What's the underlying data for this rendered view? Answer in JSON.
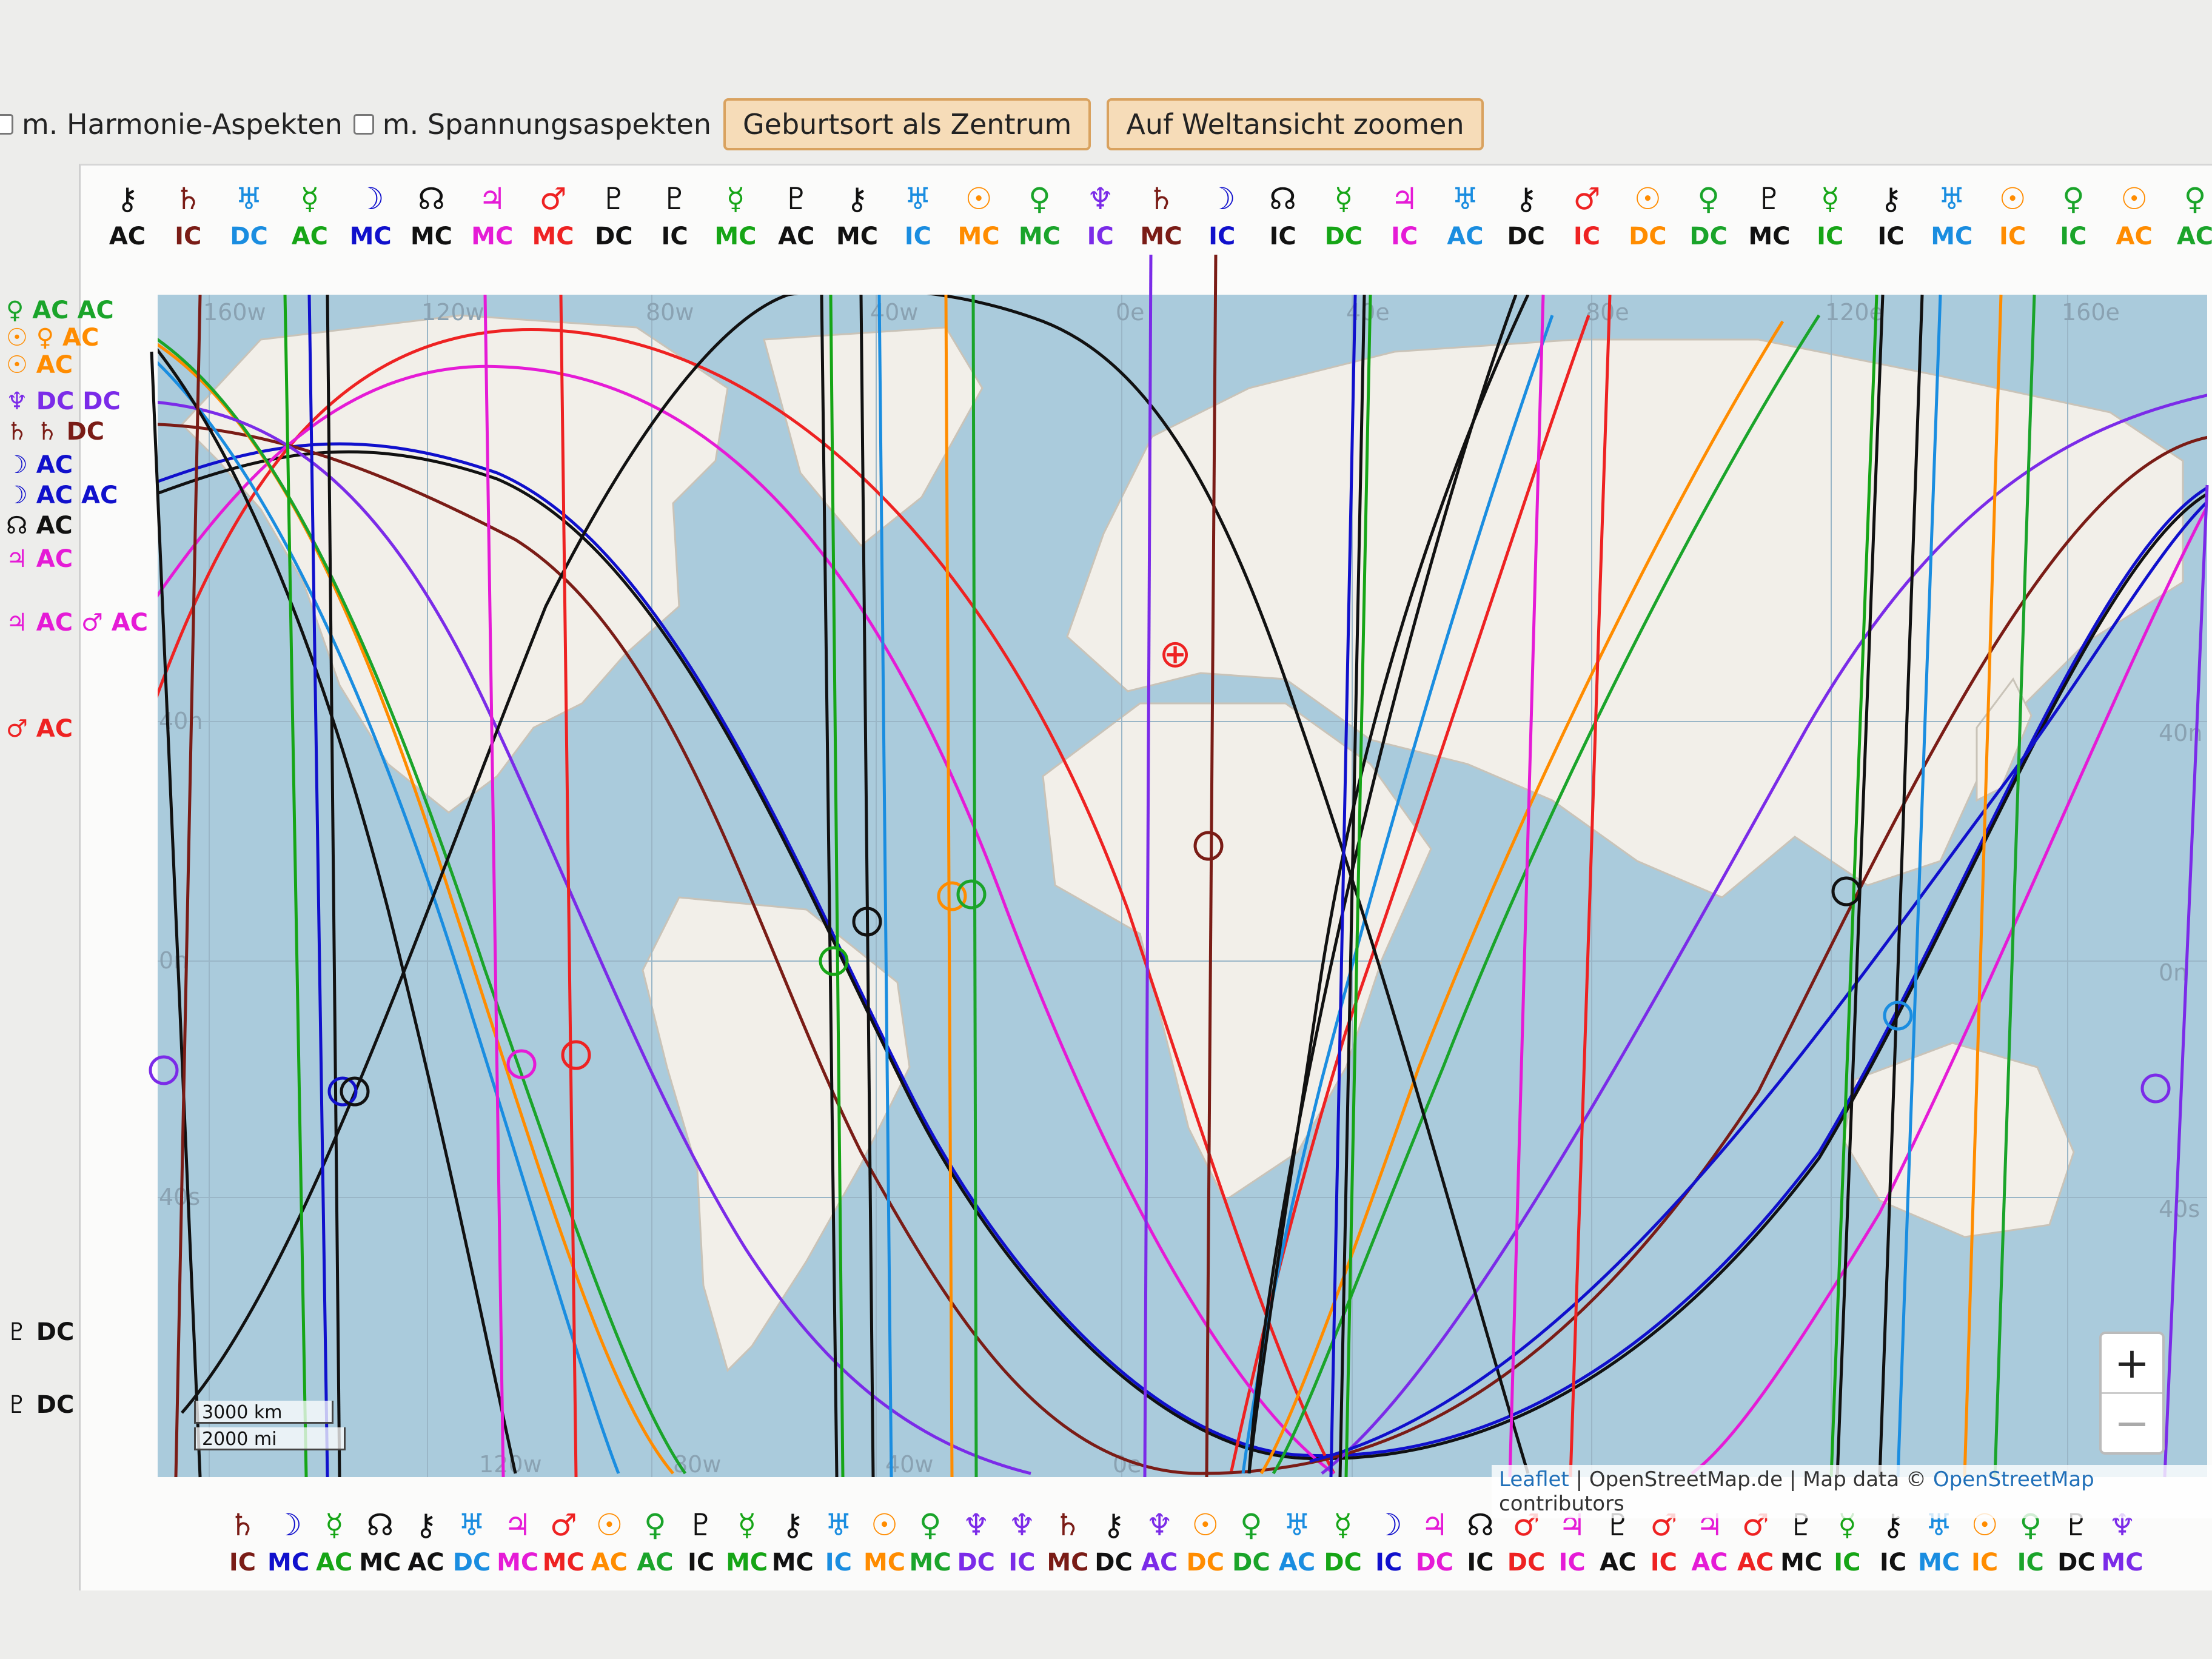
{
  "toolbar": {
    "harmony_label": "m. Harmonie-Aspekten",
    "tension_label": "m. Spannungsaspekten",
    "center_button": "Geburtsort als Zentrum",
    "zoom_world_button": "Auf Weltansicht zoomen"
  },
  "map": {
    "lon_labels": [
      "160w",
      "120w",
      "80w",
      "40w",
      "0e",
      "40e",
      "80e",
      "120e",
      "160e"
    ],
    "lon_bottom_labels": [
      "120w",
      "80w",
      "40w",
      "0e"
    ],
    "lat_labels_left": [
      "40n",
      "0n",
      "40s"
    ],
    "lat_labels_right": [
      "40n",
      "0n",
      "40s"
    ],
    "scale": [
      "3000 km",
      "2000 mi"
    ],
    "zoom_in": "+",
    "zoom_out": "−",
    "attribution": {
      "leaflet": "Leaflet",
      "sep1": " | OpenStreetMap.de | Map data © ",
      "osm": "OpenStreetMap",
      "contributors": " contributors"
    },
    "colors": {
      "ocean": "#aacbdc",
      "land": "#f2efe9",
      "mars": "#ee2222",
      "jupiter": "#e51bd6",
      "saturn": "#7a1c16",
      "sun": "#ff8c00",
      "venus": "#1aa42a",
      "mercury": "#16a516",
      "moon": "#1010cc",
      "neptune": "#7b2be8",
      "uranus": "#1a8de0",
      "pluto": "#111111",
      "node": "#111111",
      "chiron": "#111111"
    }
  },
  "top_labels": [
    {
      "sym": "⚷",
      "ang": "AC",
      "color": "#111111"
    },
    {
      "sym": "♄",
      "ang": "IC",
      "color": "#7a1c16"
    },
    {
      "sym": "♅",
      "ang": "DC",
      "color": "#1a8de0"
    },
    {
      "sym": "☿",
      "ang": "AC",
      "color": "#16a516"
    },
    {
      "sym": "☽",
      "ang": "MC",
      "color": "#1010cc"
    },
    {
      "sym": "☊",
      "ang": "MC",
      "color": "#111111"
    },
    {
      "sym": "♃",
      "ang": "MC",
      "color": "#e51bd6"
    },
    {
      "sym": "♂",
      "ang": "MC",
      "color": "#ee2222"
    },
    {
      "sym": "♇",
      "ang": "DC",
      "color": "#111111"
    },
    {
      "sym": "♇",
      "ang": "IC",
      "color": "#111111"
    },
    {
      "sym": "☿",
      "ang": "MC",
      "color": "#16a516"
    },
    {
      "sym": "♇",
      "ang": "AC",
      "color": "#111111"
    },
    {
      "sym": "⚷",
      "ang": "MC",
      "color": "#111111"
    },
    {
      "sym": "♅",
      "ang": "IC",
      "color": "#1a8de0"
    },
    {
      "sym": "☉",
      "ang": "MC",
      "color": "#ff8c00"
    },
    {
      "sym": "♀",
      "ang": "MC",
      "color": "#1aa42a"
    },
    {
      "sym": "♆",
      "ang": "IC",
      "color": "#7b2be8"
    },
    {
      "sym": "♄",
      "ang": "MC",
      "color": "#7a1c16"
    },
    {
      "sym": "☽",
      "ang": "IC",
      "color": "#1010cc"
    },
    {
      "sym": "☊",
      "ang": "IC",
      "color": "#111111"
    },
    {
      "sym": "☿",
      "ang": "DC",
      "color": "#16a516"
    },
    {
      "sym": "♃",
      "ang": "IC",
      "color": "#e51bd6"
    },
    {
      "sym": "♅",
      "ang": "AC",
      "color": "#1a8de0"
    },
    {
      "sym": "⚷",
      "ang": "DC",
      "color": "#111111"
    },
    {
      "sym": "♂",
      "ang": "IC",
      "color": "#ee2222"
    },
    {
      "sym": "☉",
      "ang": "DC",
      "color": "#ff8c00"
    },
    {
      "sym": "♀",
      "ang": "DC",
      "color": "#1aa42a"
    },
    {
      "sym": "♇",
      "ang": "MC",
      "color": "#111111"
    },
    {
      "sym": "☿",
      "ang": "IC",
      "color": "#16a516"
    },
    {
      "sym": "⚷",
      "ang": "IC",
      "color": "#111111"
    },
    {
      "sym": "♅",
      "ang": "MC",
      "color": "#1a8de0"
    },
    {
      "sym": "☉",
      "ang": "IC",
      "color": "#ff8c00"
    },
    {
      "sym": "♀",
      "ang": "IC",
      "color": "#1aa42a"
    },
    {
      "sym": "☉",
      "ang": "AC",
      "color": "#ff8c00"
    },
    {
      "sym": "♀",
      "ang": "AC",
      "color": "#1aa42a"
    }
  ],
  "bottom_labels": [
    {
      "sym": "♄",
      "ang": "IC",
      "color": "#7a1c16"
    },
    {
      "sym": "☽",
      "ang": "MC",
      "color": "#1010cc"
    },
    {
      "sym": "☿",
      "ang": "AC",
      "color": "#16a516"
    },
    {
      "sym": "☊",
      "ang": "MC",
      "color": "#111111"
    },
    {
      "sym": "⚷",
      "ang": "AC",
      "color": "#111111"
    },
    {
      "sym": "♅",
      "ang": "DC",
      "color": "#1a8de0"
    },
    {
      "sym": "♃",
      "ang": "MC",
      "color": "#e51bd6"
    },
    {
      "sym": "♂",
      "ang": "MC",
      "color": "#ee2222"
    },
    {
      "sym": "☉",
      "ang": "AC",
      "color": "#ff8c00"
    },
    {
      "sym": "♀",
      "ang": "AC",
      "color": "#1aa42a"
    },
    {
      "sym": "♇",
      "ang": "IC",
      "color": "#111111"
    },
    {
      "sym": "☿",
      "ang": "MC",
      "color": "#16a516"
    },
    {
      "sym": "⚷",
      "ang": "MC",
      "color": "#111111"
    },
    {
      "sym": "♅",
      "ang": "IC",
      "color": "#1a8de0"
    },
    {
      "sym": "☉",
      "ang": "MC",
      "color": "#ff8c00"
    },
    {
      "sym": "♀",
      "ang": "MC",
      "color": "#1aa42a"
    },
    {
      "sym": "♆",
      "ang": "DC",
      "color": "#7b2be8"
    },
    {
      "sym": "♆",
      "ang": "IC",
      "color": "#7b2be8"
    },
    {
      "sym": "♄",
      "ang": "MC",
      "color": "#7a1c16"
    },
    {
      "sym": "⚷",
      "ang": "DC",
      "color": "#111111"
    },
    {
      "sym": "♆",
      "ang": "AC",
      "color": "#7b2be8"
    },
    {
      "sym": "☉",
      "ang": "DC",
      "color": "#ff8c00"
    },
    {
      "sym": "♀",
      "ang": "DC",
      "color": "#1aa42a"
    },
    {
      "sym": "♅",
      "ang": "AC",
      "color": "#1a8de0"
    },
    {
      "sym": "☿",
      "ang": "DC",
      "color": "#16a516"
    },
    {
      "sym": "☽",
      "ang": "IC",
      "color": "#1010cc"
    },
    {
      "sym": "♃",
      "ang": "DC",
      "color": "#e51bd6"
    },
    {
      "sym": "☊",
      "ang": "IC",
      "color": "#111111"
    },
    {
      "sym": "♂",
      "ang": "DC",
      "color": "#ee2222"
    },
    {
      "sym": "♃",
      "ang": "IC",
      "color": "#e51bd6"
    },
    {
      "sym": "♇",
      "ang": "AC",
      "color": "#111111"
    },
    {
      "sym": "♂",
      "ang": "IC",
      "color": "#ee2222"
    },
    {
      "sym": "♃",
      "ang": "AC",
      "color": "#e51bd6"
    },
    {
      "sym": "♂",
      "ang": "AC",
      "color": "#ee2222"
    },
    {
      "sym": "♇",
      "ang": "MC",
      "color": "#111111"
    },
    {
      "sym": "☿",
      "ang": "IC",
      "color": "#16a516"
    },
    {
      "sym": "⚷",
      "ang": "IC",
      "color": "#111111"
    },
    {
      "sym": "♅",
      "ang": "MC",
      "color": "#1a8de0"
    },
    {
      "sym": "☉",
      "ang": "IC",
      "color": "#ff8c00"
    },
    {
      "sym": "♀",
      "ang": "IC",
      "color": "#1aa42a"
    },
    {
      "sym": "♇",
      "ang": "DC",
      "color": "#111111"
    },
    {
      "sym": "♆",
      "ang": "MC",
      "color": "#7b2be8"
    }
  ],
  "side_labels": [
    {
      "text": "♀ AC AC",
      "color": "#1aa42a"
    },
    {
      "text": "☉ ♀ AC",
      "color": "#ff8c00"
    },
    {
      "text": "☉ AC",
      "color": "#ff8c00"
    },
    {
      "text": "♆ DC DC",
      "color": "#7b2be8"
    },
    {
      "text": "♄ ♄ DC",
      "color": "#7a1c16"
    },
    {
      "text": "☽ AC",
      "color": "#1010cc"
    },
    {
      "text": "☽ AC AC",
      "color": "#1010cc"
    },
    {
      "text": "☊ AC",
      "color": "#111111"
    },
    {
      "text": "♃ AC",
      "color": "#e51bd6"
    },
    {
      "text": "♃ AC ♂ AC",
      "color": "#e51bd6"
    },
    {
      "text": "♂ AC",
      "color": "#ee2222"
    },
    {
      "text": "♇ DC",
      "color": "#111111"
    },
    {
      "text": "♇ DC",
      "color": "#111111"
    }
  ],
  "birthplace_symbol": "⊕"
}
